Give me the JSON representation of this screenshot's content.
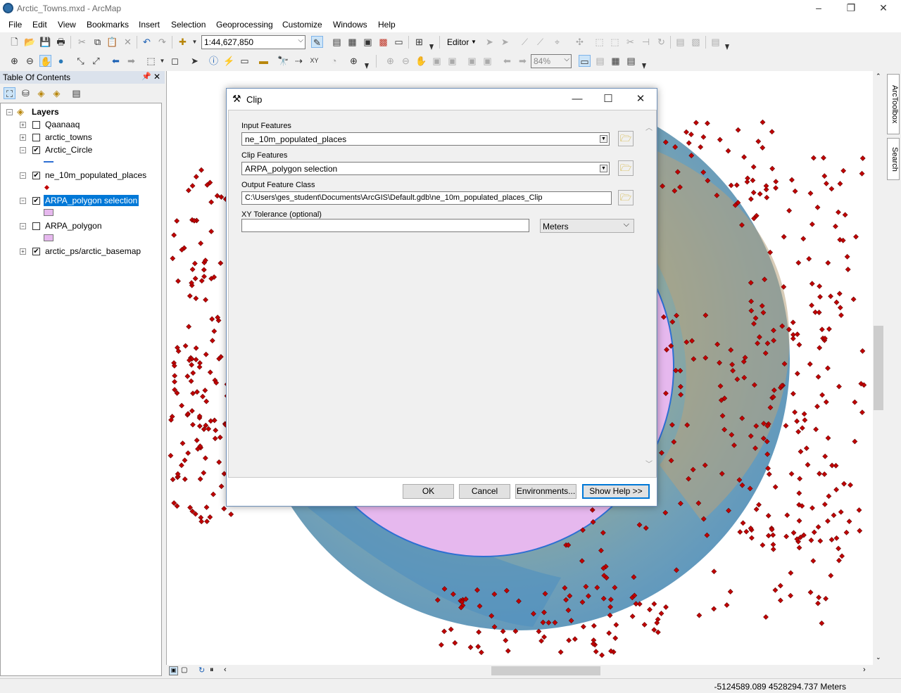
{
  "window": {
    "title": "Arctic_Towns.mxd - ArcMap"
  },
  "menu": [
    "File",
    "Edit",
    "View",
    "Bookmarks",
    "Insert",
    "Selection",
    "Geoprocessing",
    "Customize",
    "Windows",
    "Help"
  ],
  "toolbar": {
    "scale": "1:44,627,850",
    "editor_label": "Editor",
    "zoom_percent": "84%"
  },
  "toc": {
    "title": "Table Of Contents",
    "root": "Layers",
    "layers": [
      {
        "name": "Qaanaaq",
        "checked": false,
        "symbol": "none"
      },
      {
        "name": "arctic_towns",
        "checked": false,
        "symbol": "none"
      },
      {
        "name": "Arctic_Circle",
        "checked": true,
        "symbol": "line"
      },
      {
        "name": "ne_10m_populated_places",
        "checked": true,
        "symbol": "point"
      },
      {
        "name": "ARPA_polygon selection",
        "checked": true,
        "symbol": "polygon",
        "selected": true
      },
      {
        "name": "ARPA_polygon",
        "checked": false,
        "symbol": "polygon"
      },
      {
        "name": "arctic_ps/arctic_basemap",
        "checked": true,
        "symbol": "none"
      }
    ]
  },
  "dock": {
    "tab1": "ArcToolbox",
    "tab2": "Search"
  },
  "status": {
    "coords": "-5124589.089  4528294.737 Meters"
  },
  "dialog": {
    "title": "Clip",
    "input_label": "Input Features",
    "input_value": "ne_10m_populated_places",
    "clip_label": "Clip Features",
    "clip_value": "ARPA_polygon selection",
    "output_label": "Output Feature Class",
    "output_value": "C:\\Users\\ges_student\\Documents\\ArcGIS\\Default.gdb\\ne_10m_populated_places_Clip",
    "xy_label": "XY Tolerance (optional)",
    "xy_value": "",
    "units": "Meters",
    "ok": "OK",
    "cancel": "Cancel",
    "environments": "Environments...",
    "show_help": "Show Help >>"
  },
  "colors": {
    "selection": "#0078d7",
    "points": "#c00000",
    "polygon": "#e6b8ee",
    "circle": "#2d6fd3"
  }
}
